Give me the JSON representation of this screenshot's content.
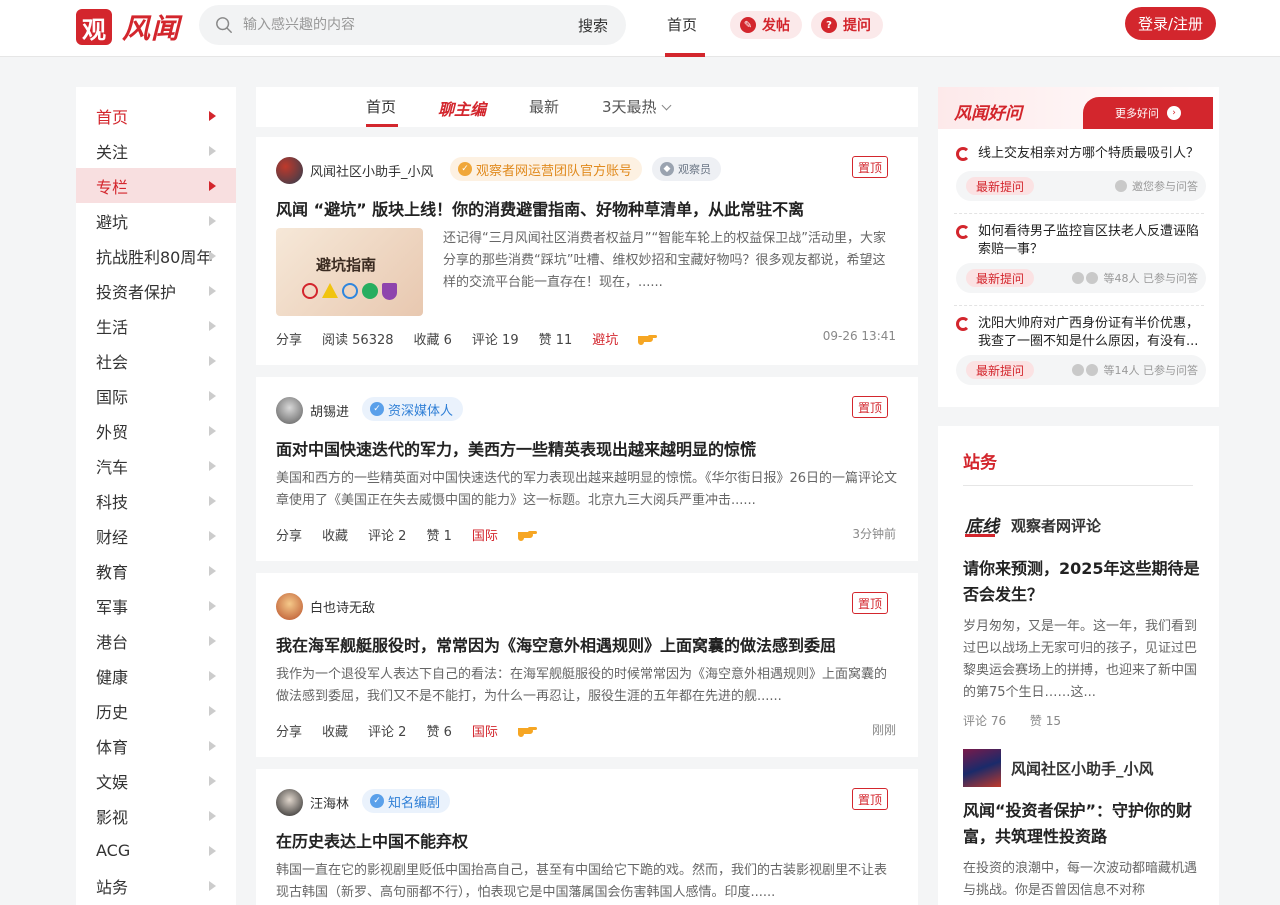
{
  "header": {
    "logo_char": "观",
    "logo_text": "风闻",
    "search_placeholder": "输入感兴趣的内容",
    "search_button": "搜索",
    "nav_home": "首页",
    "post_button": "发帖",
    "ask_button": "提问",
    "login_button": "登录/注册"
  },
  "sidebar": {
    "items": [
      {
        "label": "首页"
      },
      {
        "label": "关注"
      },
      {
        "label": "专栏"
      },
      {
        "label": "避坑"
      },
      {
        "label": "抗战胜利80周年"
      },
      {
        "label": "投资者保护"
      },
      {
        "label": "生活"
      },
      {
        "label": "社会"
      },
      {
        "label": "国际"
      },
      {
        "label": "外贸"
      },
      {
        "label": "汽车"
      },
      {
        "label": "科技"
      },
      {
        "label": "财经"
      },
      {
        "label": "教育"
      },
      {
        "label": "军事"
      },
      {
        "label": "港台"
      },
      {
        "label": "健康"
      },
      {
        "label": "历史"
      },
      {
        "label": "体育"
      },
      {
        "label": "文娱"
      },
      {
        "label": "影视"
      },
      {
        "label": "ACG"
      },
      {
        "label": "站务"
      }
    ]
  },
  "feed_tabs": {
    "home": "首页",
    "editor": "聊主编",
    "latest": "最新",
    "hot": "3天最热"
  },
  "posts": [
    {
      "author": "风闻社区小助手_小风",
      "badge": "观察者网运营团队官方账号",
      "badge2": "观察员",
      "pin": "置顶",
      "title": "风闻 “避坑” 版块上线！你的消费避雷指南、好物种草清单，从此常驻不离",
      "excerpt": "还记得“三月风闻社区消费者权益月”“智能车轮上的权益保卫战”活动里，大家分享的那些消费“踩坑”吐槽、维权妙招和宝藏好物吗？很多观友都说，希望这样的交流平台能一直存在！现在，......",
      "thumb_text": "避坑指南",
      "share": "分享",
      "read": "阅读 56328",
      "fav": "收藏  6",
      "comment": "评论  19",
      "like": "赞  11",
      "tag": "避坑",
      "time": "09-26 13:41"
    },
    {
      "author": "胡锡进",
      "badge": "资深媒体人",
      "pin": "置顶",
      "title": "面对中国快速迭代的军力，美西方一些精英表现出越来越明显的惊慌",
      "excerpt": "美国和西方的一些精英面对中国快速迭代的军力表现出越来越明显的惊慌。《华尔街日报》26日的一篇评论文章使用了《美国正在失去威慑中国的能力》这一标题。北京九三大阅兵严重冲击......",
      "share": "分享",
      "fav": "收藏",
      "comment": "评论  2",
      "like": "赞  1",
      "tag": "国际",
      "time": "3分钟前"
    },
    {
      "author": "白也诗无敌",
      "pin": "置顶",
      "title": "我在海军舰艇服役时，常常因为《海空意外相遇规则》上面窝囊的做法感到委屈",
      "excerpt": "我作为一个退役军人表达下自己的看法：在海军舰艇服役的时候常常因为《海空意外相遇规则》上面窝囊的做法感到委屈，我们又不是不能打，为什么一再忍让，服役生涯的五年都在先进的舰......",
      "share": "分享",
      "fav": "收藏",
      "comment": "评论  2",
      "like": "赞  6",
      "tag": "国际",
      "time": "刚刚"
    },
    {
      "author": "汪海林",
      "badge": "知名编剧",
      "pin": "置顶",
      "title": "在历史表达上中国不能弃权",
      "excerpt": "韩国一直在它的影视剧里贬低中国抬高自己，甚至有中国给它下跪的戏。然而，我们的古装影视剧里不让表现古韩国（新罗、高句丽都不行），怕表现它是中国藩属国会伤害韩国人感情。印度......"
    }
  ],
  "qa": {
    "title": "风闻好问",
    "more": "更多好问",
    "items": [
      {
        "question": "线上交友相亲对方哪个特质最吸引人？",
        "tag": "最新提问",
        "note": "邀您参与问答"
      },
      {
        "question": "如何看待男子监控盲区扶老人反遭诬陷索赔一事？",
        "tag": "最新提问",
        "note": "等48人 已参与问答"
      },
      {
        "question": "沈阳大帅府对广西身份证有半价优惠，我查了一圈不知是什么原因，有没有...",
        "tag": "最新提问",
        "note": "等14人 已参与问答"
      }
    ]
  },
  "site": {
    "title": "站务",
    "articles": [
      {
        "source": "观察者网评论",
        "logo_text": "底线",
        "headline": "请你来预测，2025年这些期待是否会发生？",
        "excerpt": "岁月匆匆，又是一年。这一年，我们看到过巴以战场上无家可归的孩子，见证过巴黎奥运会赛场上的拼搏，也迎来了新中国的第75个生日……这...",
        "comment": "评论  76",
        "like": "赞  15"
      },
      {
        "source": "风闻社区小助手_小风",
        "headline": "风闻“投资者保护”：守护你的财富，共筑理性投资路",
        "excerpt": "在投资的浪潮中，每一次波动都暗藏机遇与挑战。你是否曾因信息不对称"
      }
    ]
  },
  "colors": {
    "brand": "#d3262d",
    "pill_bg": "#fbe9ea",
    "page_bg": "#f4f5f6"
  }
}
